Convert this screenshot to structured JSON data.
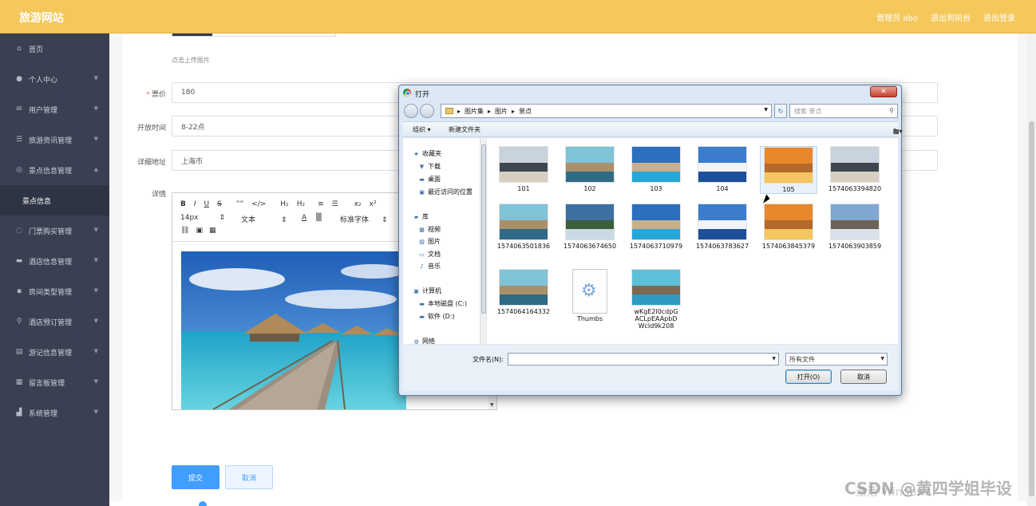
{
  "header": {
    "brand": "旅游网站",
    "admin": "管理员 abo",
    "back_front": "退出到前台",
    "logout": "退出登录"
  },
  "sidebar": {
    "items": [
      {
        "label": "首页",
        "icon": "home-icon"
      },
      {
        "label": "个人中心",
        "icon": "user-icon"
      },
      {
        "label": "用户管理",
        "icon": "mail-icon"
      },
      {
        "label": "旅游资讯管理",
        "icon": "sliders-icon"
      },
      {
        "label": "景点信息管理",
        "icon": "compass-icon"
      },
      {
        "label": "景点信息",
        "icon": ""
      },
      {
        "label": "门票购买管理",
        "icon": "ticket-icon"
      },
      {
        "label": "酒店信息管理",
        "icon": "hotel-icon"
      },
      {
        "label": "房间类型管理",
        "icon": "chat-icon"
      },
      {
        "label": "酒店预订管理",
        "icon": "mic-icon"
      },
      {
        "label": "游记信息管理",
        "icon": "note-icon"
      },
      {
        "label": "留言板管理",
        "icon": "grid-icon"
      },
      {
        "label": "系统管理",
        "icon": "chart-icon"
      }
    ]
  },
  "form": {
    "upload_hint": "点击上传图片",
    "price_label": "票价",
    "price_value": "180",
    "hours_label": "开放时间",
    "hours_value": "8-22点",
    "address_label": "详细地址",
    "address_value": "上海市",
    "detail_label": "详情",
    "submit": "提交",
    "cancel": "取消"
  },
  "editor": {
    "row1": [
      "B",
      "I",
      "U",
      "S",
      "””",
      "</>",
      "H₁",
      "H₂",
      "≡",
      "☰",
      "x₂",
      "x²"
    ],
    "font_size": "14px",
    "text_style": "文本",
    "font_family": "标准字体"
  },
  "dialog": {
    "title": "打开",
    "path": [
      "图片集",
      "图片",
      "景点"
    ],
    "search_placeholder": "搜索 景点",
    "organize": "组织 ▾",
    "new_folder": "新建文件夹",
    "tree": [
      {
        "label": "收藏夹",
        "icon": "star-icon"
      },
      {
        "label": "下载",
        "icon": "download-icon"
      },
      {
        "label": "桌面",
        "icon": "desktop-icon"
      },
      {
        "label": "最近访问的位置",
        "icon": "recent-icon"
      },
      {
        "label": "库",
        "icon": "library-icon"
      },
      {
        "label": "视频",
        "icon": "video-icon"
      },
      {
        "label": "图片",
        "icon": "picture-icon"
      },
      {
        "label": "文档",
        "icon": "document-icon"
      },
      {
        "label": "音乐",
        "icon": "music-icon"
      },
      {
        "label": "计算机",
        "icon": "computer-icon"
      },
      {
        "label": "本地磁盘 (C:)",
        "icon": "disk-icon"
      },
      {
        "label": "软件 (D:)",
        "icon": "disk-icon"
      },
      {
        "label": "网络",
        "icon": "network-icon"
      }
    ],
    "files": [
      {
        "name": "101",
        "colors": [
          "#c9d3dd",
          "#3f4650",
          "#d8cfc3"
        ]
      },
      {
        "name": "102",
        "colors": [
          "#7ec3d6",
          "#a98f6a",
          "#2f6b86"
        ]
      },
      {
        "name": "103",
        "colors": [
          "#2a6fc0",
          "#c9b08c",
          "#26a7d6"
        ]
      },
      {
        "name": "104",
        "colors": [
          "#3b7dcc",
          "#f2f4f7",
          "#1d4f9a"
        ]
      },
      {
        "name": "105",
        "colors": [
          "#e8872b",
          "#b36a2a",
          "#f5c560"
        ]
      },
      {
        "name": "1574063394820",
        "colors": [
          "#c9d3dd",
          "#3f4650",
          "#d8cfc3"
        ]
      },
      {
        "name": "1574063501836",
        "colors": [
          "#7ec3d6",
          "#a98f6a",
          "#2f6b86"
        ]
      },
      {
        "name": "1574063674650",
        "colors": [
          "#3d6fa2",
          "#3c5f3a",
          "#cbd9e6"
        ]
      },
      {
        "name": "1574063710979",
        "colors": [
          "#2a6fc0",
          "#c9b08c",
          "#26a7d6"
        ]
      },
      {
        "name": "1574063783627",
        "colors": [
          "#3b7dcc",
          "#f2f4f7",
          "#1d4f9a"
        ]
      },
      {
        "name": "1574063845379",
        "colors": [
          "#e8872b",
          "#b36a2a",
          "#f5c560"
        ]
      },
      {
        "name": "1574063903859",
        "colors": [
          "#7fa7cf",
          "#6b6357",
          "#d9e2ea"
        ]
      },
      {
        "name": "1574064164332",
        "colors": [
          "#7ec3d6",
          "#a98f6a",
          "#2f6b86"
        ]
      },
      {
        "name": "Thumbs",
        "colors": []
      },
      {
        "name": "wKgE2l0cdpGACLpEAApbDWcId9k208",
        "colors": [
          "#5ec0d8",
          "#7a6a55",
          "#2e9bc4"
        ]
      }
    ],
    "filename_label": "文件名(N):",
    "filetype": "所有文件",
    "open": "打开(O)",
    "cancel": "取消"
  },
  "watermark": "CSDN @黄四学姐毕设",
  "watermark2": "激活 Windows"
}
